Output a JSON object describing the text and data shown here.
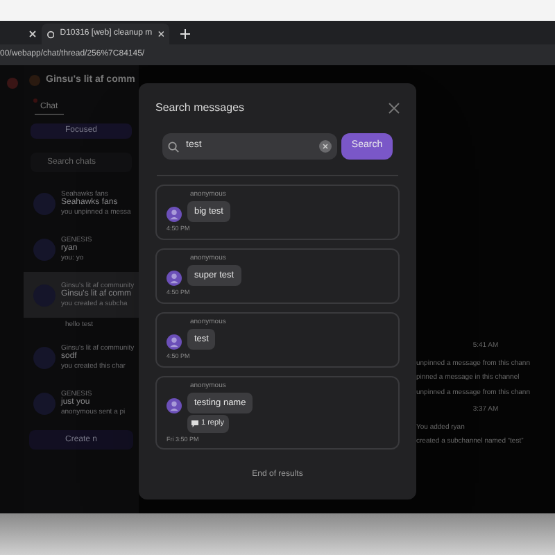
{
  "browser": {
    "tabs": [
      {
        "selected": false
      },
      {
        "title": "D10316 [web] cleanup m",
        "selected": true
      }
    ],
    "url": "00/webapp/chat/thread/256%7C84145/"
  },
  "chat_app": {
    "header": "Ginsu's lit af comm",
    "tabs": [
      {
        "label": "Chat",
        "selected": true,
        "unread": true
      }
    ],
    "focused_button": "Focused",
    "search_placeholder": "Search chats",
    "chats": [
      {
        "community": "Seahawks fans",
        "name": "Seahawks fans",
        "preview": "you unpinned a messa",
        "selected": false
      },
      {
        "community": "GENESIS",
        "name": "ryan",
        "preview": "you: yo",
        "selected": false
      },
      {
        "community": "Ginsu's lit af community",
        "name": "Ginsu's lit af comm",
        "preview": "you created a subcha",
        "selected": true,
        "children": [
          {
            "name": "hello test"
          }
        ]
      },
      {
        "community": "Ginsu's lit af community",
        "name": "sodf",
        "preview": "you created this char",
        "selected": false
      },
      {
        "community": "GENESIS",
        "name": "just you",
        "preview": "anonymous sent a pi",
        "selected": false
      }
    ],
    "create_button": "Create n",
    "events": [
      {
        "kind": "time",
        "text": "5:41 AM"
      },
      {
        "kind": "line",
        "text": "unpinned a message from this chann"
      },
      {
        "kind": "line",
        "text": "pinned a message in this channel"
      },
      {
        "kind": "line",
        "text": "unpinned a message from this chann"
      },
      {
        "kind": "time",
        "text": "3:37 AM"
      },
      {
        "kind": "line",
        "text": "You added ryan"
      },
      {
        "kind": "line",
        "text": "created a subchannel named “test”"
      }
    ]
  },
  "search_dialog": {
    "title": "Search messages",
    "query": "test",
    "button": "Search",
    "results": [
      {
        "author": "anonymous",
        "text": "big test",
        "time": "4:50 PM"
      },
      {
        "author": "anonymous",
        "text": "super test",
        "time": "4:50 PM"
      },
      {
        "author": "anonymous",
        "text": "test",
        "time": "4:50 PM"
      },
      {
        "author": "anonymous",
        "text": "testing name",
        "reply_count": "1 reply",
        "time": "Fri 3:50 PM"
      }
    ],
    "footer": "End of results"
  }
}
